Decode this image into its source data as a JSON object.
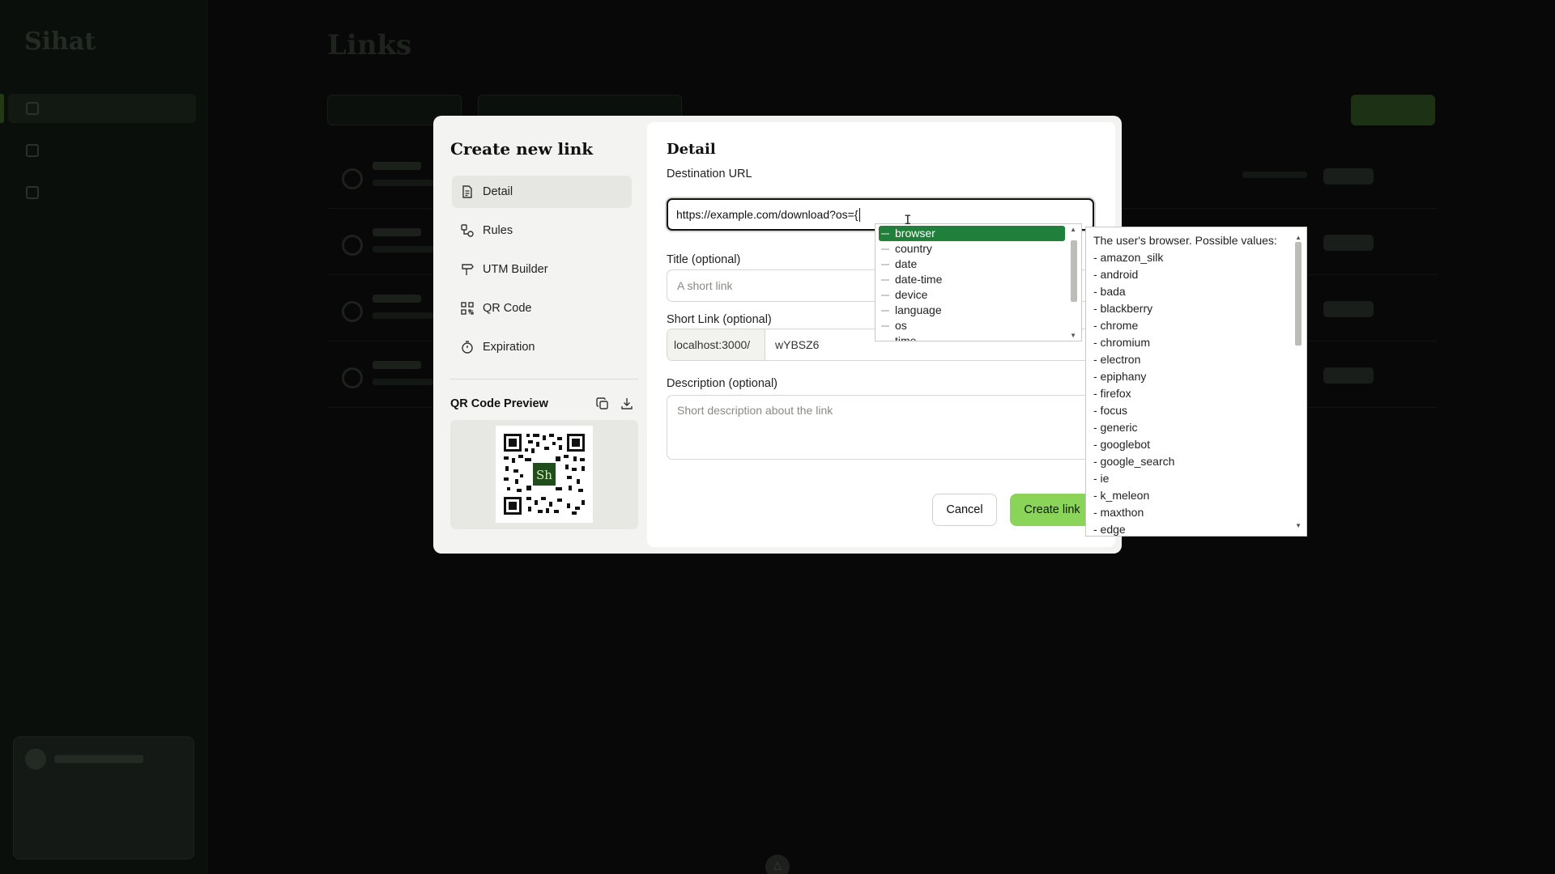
{
  "app": {
    "logo": "Sihat",
    "page_title": "Links"
  },
  "modal": {
    "title": "Create new link",
    "menu": [
      {
        "label": "Detail",
        "icon": "document-icon",
        "active": true
      },
      {
        "label": "Rules",
        "icon": "rules-icon",
        "active": false
      },
      {
        "label": "UTM Builder",
        "icon": "signpost-icon",
        "active": false
      },
      {
        "label": "QR Code",
        "icon": "qr-code-icon",
        "active": false
      },
      {
        "label": "Expiration",
        "icon": "timer-icon",
        "active": false
      }
    ],
    "qr_preview_label": "QR Code Preview",
    "qr_center_text": "Sh",
    "detail": {
      "title": "Detail",
      "destination_label": "Destination URL",
      "destination_value": "https://example.com/download?os={",
      "title_label": "Title (optional)",
      "title_placeholder": "A short link",
      "short_label": "Short Link (optional)",
      "short_prefix": "localhost:3000/",
      "short_code": "wYBSZ6",
      "description_label": "Description (optional)",
      "description_placeholder": "Short description about the link",
      "cancel_label": "Cancel",
      "create_label": "Create link"
    }
  },
  "autocomplete": {
    "items": [
      "browser",
      "country",
      "date",
      "date-time",
      "device",
      "language",
      "os",
      "time"
    ],
    "selected": "browser",
    "doc_title": "The user's browser. Possible values:",
    "doc_values": [
      "- amazon_silk",
      "- android",
      "- bada",
      "- blackberry",
      "- chrome",
      "- chromium",
      "- electron",
      "- epiphany",
      "- firefox",
      "- focus",
      "- generic",
      "- googlebot",
      "- google_search",
      "- ie",
      "- k_meleon",
      "- maxthon",
      "- edge"
    ]
  },
  "colors": {
    "accent_green": "#8bd45a",
    "selected_item": "#1f7f3b",
    "overlay": "#070807"
  }
}
